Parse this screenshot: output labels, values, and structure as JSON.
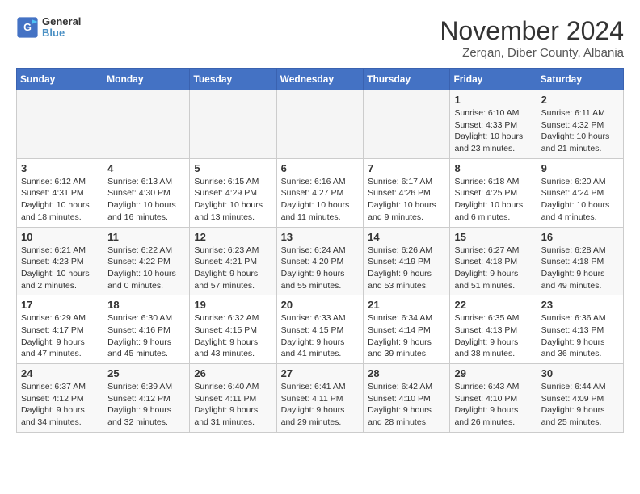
{
  "header": {
    "logo_line1": "General",
    "logo_line2": "Blue",
    "title": "November 2024",
    "subtitle": "Zerqan, Diber County, Albania"
  },
  "weekdays": [
    "Sunday",
    "Monday",
    "Tuesday",
    "Wednesday",
    "Thursday",
    "Friday",
    "Saturday"
  ],
  "weeks": [
    [
      {
        "day": "",
        "info": ""
      },
      {
        "day": "",
        "info": ""
      },
      {
        "day": "",
        "info": ""
      },
      {
        "day": "",
        "info": ""
      },
      {
        "day": "",
        "info": ""
      },
      {
        "day": "1",
        "info": "Sunrise: 6:10 AM\nSunset: 4:33 PM\nDaylight: 10 hours\nand 23 minutes."
      },
      {
        "day": "2",
        "info": "Sunrise: 6:11 AM\nSunset: 4:32 PM\nDaylight: 10 hours\nand 21 minutes."
      }
    ],
    [
      {
        "day": "3",
        "info": "Sunrise: 6:12 AM\nSunset: 4:31 PM\nDaylight: 10 hours\nand 18 minutes."
      },
      {
        "day": "4",
        "info": "Sunrise: 6:13 AM\nSunset: 4:30 PM\nDaylight: 10 hours\nand 16 minutes."
      },
      {
        "day": "5",
        "info": "Sunrise: 6:15 AM\nSunset: 4:29 PM\nDaylight: 10 hours\nand 13 minutes."
      },
      {
        "day": "6",
        "info": "Sunrise: 6:16 AM\nSunset: 4:27 PM\nDaylight: 10 hours\nand 11 minutes."
      },
      {
        "day": "7",
        "info": "Sunrise: 6:17 AM\nSunset: 4:26 PM\nDaylight: 10 hours\nand 9 minutes."
      },
      {
        "day": "8",
        "info": "Sunrise: 6:18 AM\nSunset: 4:25 PM\nDaylight: 10 hours\nand 6 minutes."
      },
      {
        "day": "9",
        "info": "Sunrise: 6:20 AM\nSunset: 4:24 PM\nDaylight: 10 hours\nand 4 minutes."
      }
    ],
    [
      {
        "day": "10",
        "info": "Sunrise: 6:21 AM\nSunset: 4:23 PM\nDaylight: 10 hours\nand 2 minutes."
      },
      {
        "day": "11",
        "info": "Sunrise: 6:22 AM\nSunset: 4:22 PM\nDaylight: 10 hours\nand 0 minutes."
      },
      {
        "day": "12",
        "info": "Sunrise: 6:23 AM\nSunset: 4:21 PM\nDaylight: 9 hours\nand 57 minutes."
      },
      {
        "day": "13",
        "info": "Sunrise: 6:24 AM\nSunset: 4:20 PM\nDaylight: 9 hours\nand 55 minutes."
      },
      {
        "day": "14",
        "info": "Sunrise: 6:26 AM\nSunset: 4:19 PM\nDaylight: 9 hours\nand 53 minutes."
      },
      {
        "day": "15",
        "info": "Sunrise: 6:27 AM\nSunset: 4:18 PM\nDaylight: 9 hours\nand 51 minutes."
      },
      {
        "day": "16",
        "info": "Sunrise: 6:28 AM\nSunset: 4:18 PM\nDaylight: 9 hours\nand 49 minutes."
      }
    ],
    [
      {
        "day": "17",
        "info": "Sunrise: 6:29 AM\nSunset: 4:17 PM\nDaylight: 9 hours\nand 47 minutes."
      },
      {
        "day": "18",
        "info": "Sunrise: 6:30 AM\nSunset: 4:16 PM\nDaylight: 9 hours\nand 45 minutes."
      },
      {
        "day": "19",
        "info": "Sunrise: 6:32 AM\nSunset: 4:15 PM\nDaylight: 9 hours\nand 43 minutes."
      },
      {
        "day": "20",
        "info": "Sunrise: 6:33 AM\nSunset: 4:15 PM\nDaylight: 9 hours\nand 41 minutes."
      },
      {
        "day": "21",
        "info": "Sunrise: 6:34 AM\nSunset: 4:14 PM\nDaylight: 9 hours\nand 39 minutes."
      },
      {
        "day": "22",
        "info": "Sunrise: 6:35 AM\nSunset: 4:13 PM\nDaylight: 9 hours\nand 38 minutes."
      },
      {
        "day": "23",
        "info": "Sunrise: 6:36 AM\nSunset: 4:13 PM\nDaylight: 9 hours\nand 36 minutes."
      }
    ],
    [
      {
        "day": "24",
        "info": "Sunrise: 6:37 AM\nSunset: 4:12 PM\nDaylight: 9 hours\nand 34 minutes."
      },
      {
        "day": "25",
        "info": "Sunrise: 6:39 AM\nSunset: 4:12 PM\nDaylight: 9 hours\nand 32 minutes."
      },
      {
        "day": "26",
        "info": "Sunrise: 6:40 AM\nSunset: 4:11 PM\nDaylight: 9 hours\nand 31 minutes."
      },
      {
        "day": "27",
        "info": "Sunrise: 6:41 AM\nSunset: 4:11 PM\nDaylight: 9 hours\nand 29 minutes."
      },
      {
        "day": "28",
        "info": "Sunrise: 6:42 AM\nSunset: 4:10 PM\nDaylight: 9 hours\nand 28 minutes."
      },
      {
        "day": "29",
        "info": "Sunrise: 6:43 AM\nSunset: 4:10 PM\nDaylight: 9 hours\nand 26 minutes."
      },
      {
        "day": "30",
        "info": "Sunrise: 6:44 AM\nSunset: 4:09 PM\nDaylight: 9 hours\nand 25 minutes."
      }
    ]
  ]
}
